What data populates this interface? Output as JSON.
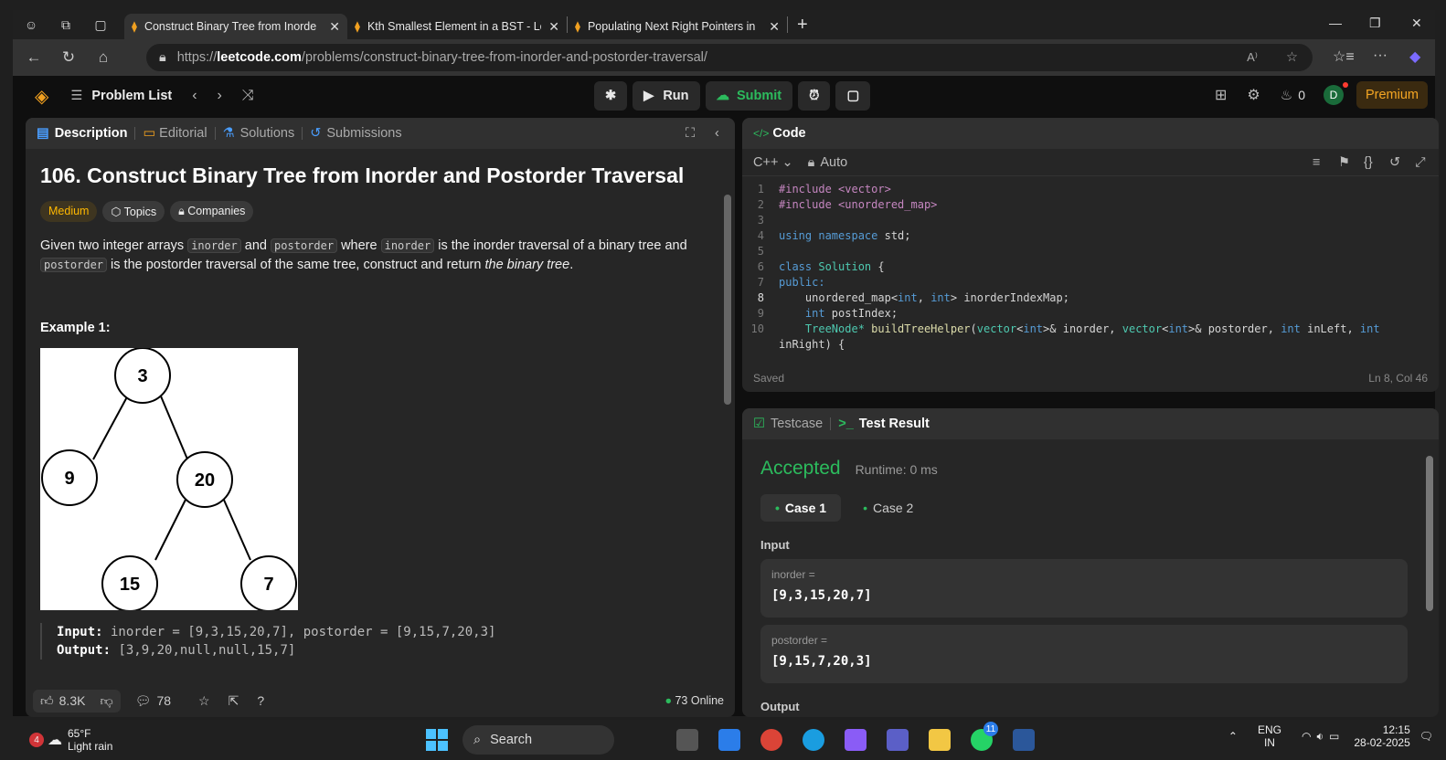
{
  "browser": {
    "tabs": [
      {
        "title": "Construct Binary Tree from Inorde"
      },
      {
        "title": "Kth Smallest Element in a BST - Le"
      },
      {
        "title": "Populating Next Right Pointers in"
      }
    ],
    "url_prefix": "https://",
    "url_domain": "leetcode.com",
    "url_path": "/problems/construct-binary-tree-from-inorder-and-postorder-traversal/",
    "read_aloud": "A⁾"
  },
  "lc": {
    "problem_list": "Problem List",
    "run": "Run",
    "submit": "Submit",
    "streak": "0",
    "avatar": "D",
    "premium": "Premium"
  },
  "left": {
    "tabs": [
      "Description",
      "Editorial",
      "Solutions",
      "Submissions"
    ],
    "title": "106. Construct Binary Tree from Inorder and Postorder Traversal",
    "difficulty": "Medium",
    "topics": "Topics",
    "companies": "Companies",
    "para_1": "Given two integer arrays ",
    "code_inorder": "inorder",
    "para_2": " and ",
    "code_postorder": "postorder",
    "para_3": " where ",
    "para_4": " is the inorder traversal of a binary tree and ",
    "para_5": " is the postorder traversal of the same tree, construct and return ",
    "para_em": "the binary tree",
    "para_6": ".",
    "example_title": "Example 1:",
    "tree_nodes": [
      "3",
      "9",
      "20",
      "15",
      "7"
    ],
    "input_label": "Input:",
    "input_value": " inorder = [9,3,15,20,7], postorder = [9,15,7,20,3]",
    "output_label": "Output:",
    "output_value": " [3,9,20,null,null,15,7]",
    "likes": "8.3K",
    "comments": "78",
    "online": "73 Online"
  },
  "code": {
    "header": "Code",
    "language": "C++",
    "mode": "Auto",
    "saved": "Saved",
    "position": "Ln 8, Col 46"
  },
  "test": {
    "tabs": [
      "Testcase",
      "Test Result"
    ],
    "status": "Accepted",
    "runtime": "Runtime: 0 ms",
    "cases": [
      "Case 1",
      "Case 2"
    ],
    "input_label": "Input",
    "inorder_key": "inorder =",
    "inorder_val": "[9,3,15,20,7]",
    "postorder_key": "postorder =",
    "postorder_val": "[9,15,7,20,3]",
    "output_label": "Output"
  },
  "taskbar": {
    "weather_badge": "4",
    "temp": "65°F",
    "weather": "Light rain",
    "search": "Search",
    "whatsapp_badge": "11",
    "lang": "ENG",
    "region": "IN",
    "time": "12:15",
    "date": "28-02-2025"
  }
}
